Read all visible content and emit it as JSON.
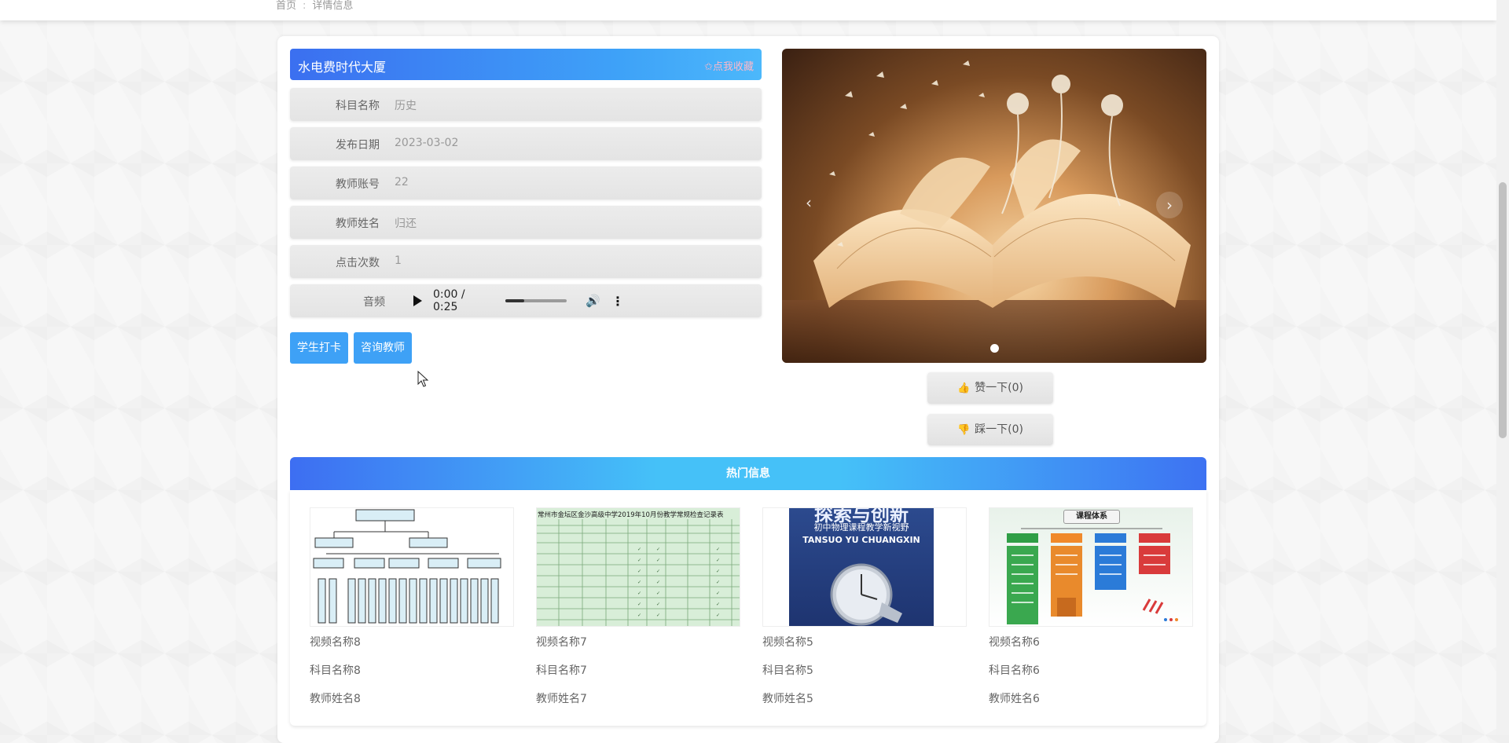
{
  "breadcrumb": {
    "home": "首页",
    "separator": ":",
    "current": "详情信息"
  },
  "detail": {
    "title": "水电费时代大厦",
    "favorite_label": "✩点我收藏",
    "fields": [
      {
        "label": "科目名称",
        "value": "历史"
      },
      {
        "label": "发布日期",
        "value": "2023-03-02"
      },
      {
        "label": "教师账号",
        "value": "22"
      },
      {
        "label": "教师姓名",
        "value": "归还"
      },
      {
        "label": "点击次数",
        "value": "1"
      }
    ],
    "audio": {
      "label": "音频",
      "time": "0:00 / 0:25",
      "progress": 0.3
    },
    "buttons": {
      "checkin": "学生打卡",
      "consult": "咨询教师"
    }
  },
  "carousel": {
    "prev_icon": "‹",
    "next_icon": "›",
    "active_index": 0,
    "slides": 1
  },
  "votes": {
    "like_label": "赞一下(0)",
    "dislike_label": "踩一下(0)"
  },
  "hot": {
    "title": "热门信息",
    "items": [
      {
        "name": "视频名称8",
        "subject": "科目名称8",
        "teacher": "教师姓名8"
      },
      {
        "name": "视频名称7",
        "subject": "科目名称7",
        "teacher": "教师姓名7"
      },
      {
        "name": "视频名称5",
        "subject": "科目名称5",
        "teacher": "教师姓名5"
      },
      {
        "name": "视频名称6",
        "subject": "科目名称6",
        "teacher": "教师姓名6"
      }
    ],
    "thumb_texts": {
      "t2_title": "常州市金坛区金沙高级中学2019年10月份教学常规检查记录表",
      "t3_big": "探索与创新",
      "t3_sub": "初中物理课程教学新视野",
      "t3_pinyin": "TANSUO YU CHUANGXIN",
      "t4_title": "课程体系"
    }
  },
  "colors": {
    "accent": "#3ea1f6",
    "header_gradient_start": "#3d6ef2",
    "header_gradient_mid": "#45c1f8"
  }
}
